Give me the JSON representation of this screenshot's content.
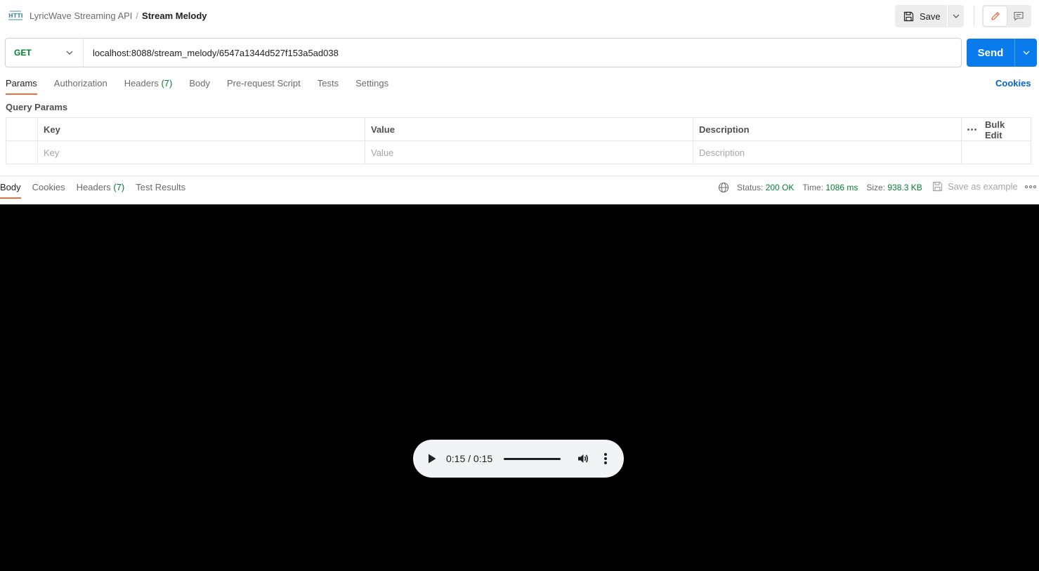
{
  "header": {
    "collection": "LyricWave Streaming API",
    "separator": "/",
    "request_name": "Stream Melody",
    "save_label": "Save"
  },
  "request": {
    "method": "GET",
    "url": "localhost:8088/stream_melody/6547a1344d527f153a5ad038",
    "send_label": "Send"
  },
  "request_tabs": [
    {
      "label": "Params",
      "count": ""
    },
    {
      "label": "Authorization",
      "count": ""
    },
    {
      "label": "Headers",
      "count": "(7)"
    },
    {
      "label": "Body",
      "count": ""
    },
    {
      "label": "Pre-request Script",
      "count": ""
    },
    {
      "label": "Tests",
      "count": ""
    },
    {
      "label": "Settings",
      "count": ""
    }
  ],
  "cookies_label": "Cookies",
  "query_params": {
    "title": "Query Params",
    "columns": {
      "key": "Key",
      "value": "Value",
      "description": "Description"
    },
    "bulk_edit_label": "Bulk Edit",
    "placeholders": {
      "key": "Key",
      "value": "Value",
      "description": "Description"
    }
  },
  "response": {
    "tabs": [
      {
        "label": "Body",
        "count": ""
      },
      {
        "label": "Cookies",
        "count": ""
      },
      {
        "label": "Headers",
        "count": "(7)"
      },
      {
        "label": "Test Results",
        "count": ""
      }
    ],
    "status_label": "Status:",
    "status_value": "200 OK",
    "time_label": "Time:",
    "time_value": "1086 ms",
    "size_label": "Size:",
    "size_value": "938.3 KB",
    "save_example_label": "Save as example"
  },
  "audio": {
    "time": "0:15 / 0:15",
    "progress_fraction": 1.0
  },
  "colors": {
    "accent_orange": "#f26b3a",
    "send_blue": "#097bed",
    "success_green": "#007f31",
    "link_blue": "#0265d2"
  }
}
